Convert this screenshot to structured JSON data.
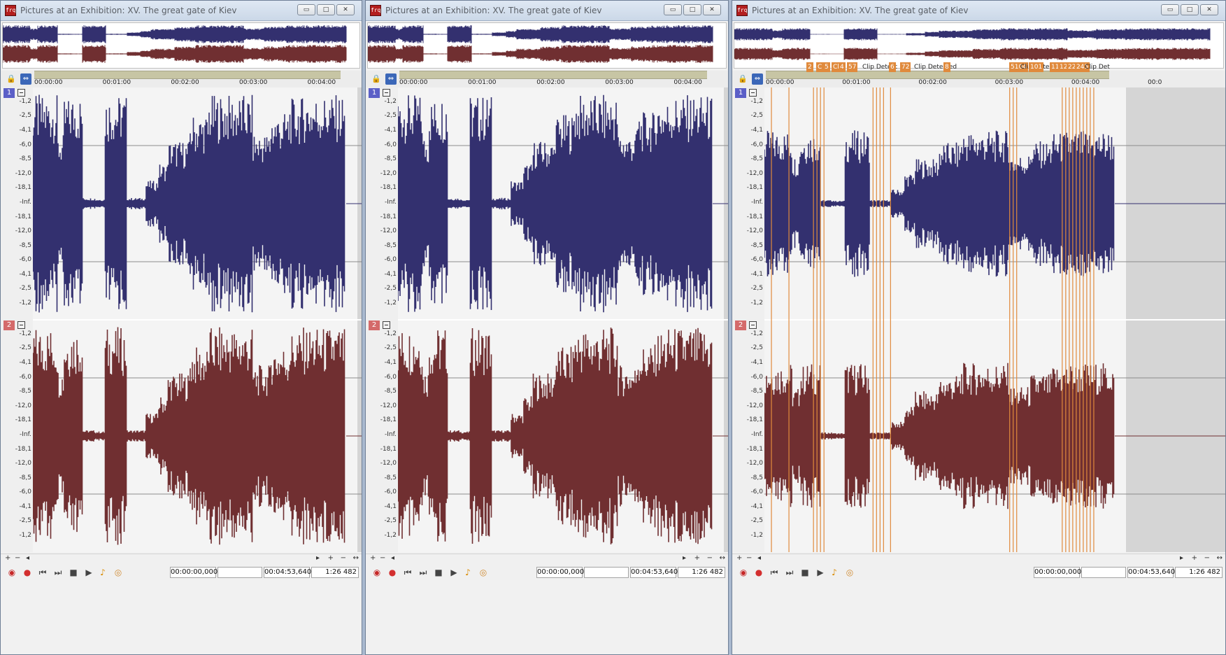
{
  "windows": [
    {
      "id": "w1",
      "title": "Pictures at an Exhibition: XV. The great gate of Kiev",
      "show_clips": false
    },
    {
      "id": "w2",
      "title": "Pictures at an Exhibition: XV. The great gate of Kiev",
      "show_clips": false
    },
    {
      "id": "w3",
      "title": "Pictures at an Exhibition: XV. The great gate of Kiev",
      "show_clips": true
    }
  ],
  "window_buttons": {
    "minimize": "▭",
    "maximize": "□",
    "close": "✕"
  },
  "ruler": {
    "ticks": [
      "00:00:00",
      "00:01:00",
      "00:02:00",
      "00:03:00",
      "00:04:00",
      "00:0"
    ]
  },
  "channels": [
    {
      "number": "1",
      "color": "#33306f",
      "badge_color": "#5b5fc7"
    },
    {
      "number": "2",
      "color": "#702f31",
      "badge_color": "#d46a6a"
    }
  ],
  "db_scale": [
    "-1,2",
    "-2,5",
    "-4,1",
    "-6,0",
    "-8,5",
    "-12,0",
    "-18,1",
    "-Inf.",
    "-18,1",
    "-12,0",
    "-8,5",
    "-6,0",
    "-4,1",
    "-2,5",
    "-1,2"
  ],
  "toolbar": {
    "position": "00:00:00,000",
    "selection": "",
    "length": "00:04:53,640",
    "zoom": "1:26 482"
  },
  "scroll": {
    "plus": "+",
    "minus": "−",
    "left": "◂",
    "right": "▸",
    "arrows": "↔"
  },
  "clip_labels": [
    "2",
    "C",
    "5",
    "Cli",
    "4",
    "57",
    "Clip Detect",
    "6",
    "72",
    "Clip Detected",
    "8",
    "5104",
    "Clip Dete",
    "101",
    "11",
    "122",
    "223",
    "245",
    "Clip Det"
  ],
  "colors": {
    "ch1": "#33306f",
    "ch2": "#702f31",
    "clip": "#e08a3c",
    "bg": "#f4f4f4"
  }
}
